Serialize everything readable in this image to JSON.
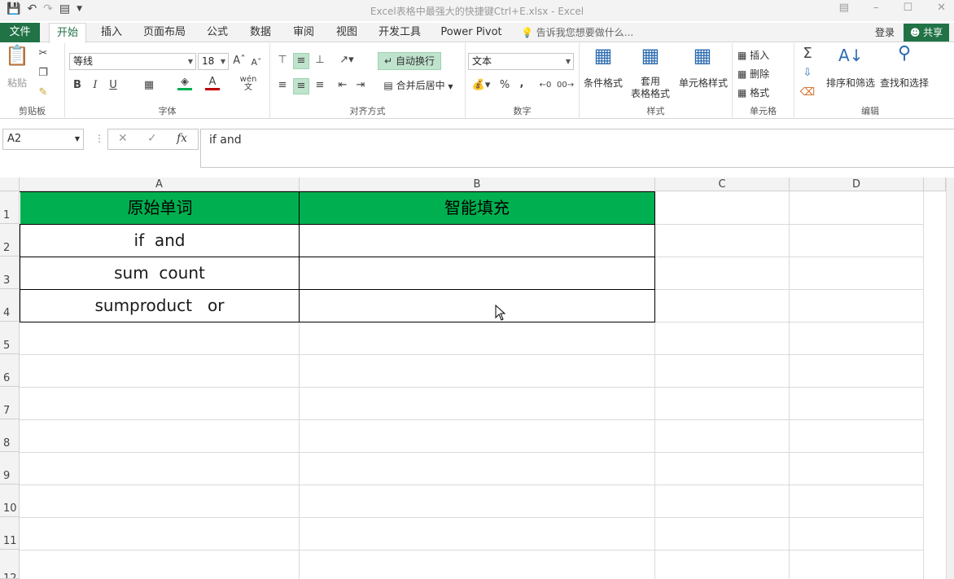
{
  "window": {
    "title": "Excel表格中最强大的快捷键Ctrl+E.xlsx - Excel"
  },
  "tabs": {
    "file": "文件",
    "items": [
      "开始",
      "插入",
      "页面布局",
      "公式",
      "数据",
      "审阅",
      "视图",
      "开发工具",
      "Power Pivot"
    ],
    "tell_me": "告诉我您想要做什么...",
    "login": "登录",
    "share": "共享"
  },
  "ribbon": {
    "clipboard": {
      "paste": "粘贴",
      "label": "剪贴板"
    },
    "font": {
      "name": "等线",
      "size": "18",
      "label": "字体",
      "bold": "B",
      "italic": "I",
      "underline": "U"
    },
    "alignment": {
      "wrap": "自动换行",
      "merge": "合并后居中",
      "label": "对齐方式"
    },
    "number": {
      "format": "文本",
      "percent": "%",
      "comma": ",",
      "label": "数字"
    },
    "styles": {
      "conditional": "条件格式",
      "table_line1": "套用",
      "table_line2": "表格格式",
      "cell_styles": "单元格样式",
      "label": "样式"
    },
    "cells": {
      "insert": "插入",
      "delete": "删除",
      "format": "格式",
      "label": "单元格"
    },
    "editing": {
      "sort": "排序和筛选",
      "find": "查找和选择",
      "label": "编辑"
    }
  },
  "formula_bar": {
    "name_box": "A2",
    "formula": "if  and"
  },
  "sheet": {
    "columns": [
      "A",
      "B",
      "C",
      "D"
    ],
    "rows": [
      "1",
      "2",
      "3",
      "4",
      "5",
      "6",
      "7",
      "8",
      "9",
      "10",
      "11",
      "12"
    ],
    "header_fill": "#00B050",
    "header": {
      "a": "原始单词",
      "b": "智能填充"
    },
    "data": [
      {
        "a": "if  and",
        "b": ""
      },
      {
        "a": "sum  count",
        "b": ""
      },
      {
        "a": "sumproduct   or",
        "b": ""
      }
    ]
  }
}
